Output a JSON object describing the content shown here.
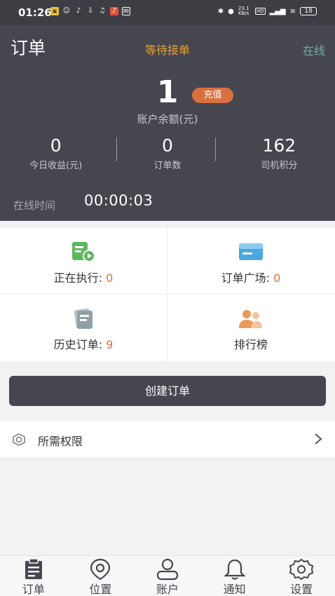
{
  "status_bar": {
    "time": "01:26",
    "network_speed": "23.1\nKB/s",
    "battery": "18"
  },
  "header": {
    "title": "订单",
    "order_status": "等待接单",
    "online_status": "在线",
    "balance_value": "1",
    "recharge_label": "充值",
    "balance_label": "账户余额(元)",
    "stats": [
      {
        "value": "0",
        "label": "今日收益(元)"
      },
      {
        "value": "0",
        "label": "订单数"
      },
      {
        "value": "162",
        "label": "司机积分"
      }
    ],
    "online_time_label": "在线时间",
    "online_time_value": "00:00:03"
  },
  "grid": {
    "executing_label": "正在执行: ",
    "executing_count": "0",
    "square_label": "订单广场: ",
    "square_count": "0",
    "history_label": "历史订单: ",
    "history_count": "9",
    "ranking_label": "排行榜"
  },
  "create_button": "创建订单",
  "permissions_label": "所需权限",
  "tabs": [
    {
      "label": "订单",
      "icon": "clipboard-icon"
    },
    {
      "label": "位置",
      "icon": "location-pin-icon"
    },
    {
      "label": "账户",
      "icon": "user-icon"
    },
    {
      "label": "通知",
      "icon": "bell-icon"
    },
    {
      "label": "设置",
      "icon": "gear-icon"
    }
  ],
  "colors": {
    "header_bg": "#45464e",
    "accent_orange": "#d9703f",
    "status_gold": "#e6a33a",
    "online_teal": "#6fb3a3"
  }
}
